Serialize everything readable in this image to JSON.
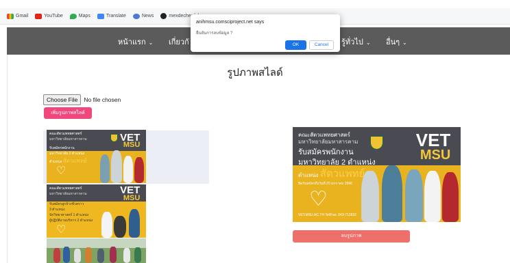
{
  "bookmarks": [
    {
      "label": "Gmail",
      "icon": "gmail-icon"
    },
    {
      "label": "YouTube",
      "icon": "youtube-icon"
    },
    {
      "label": "Maps",
      "icon": "maps-icon"
    },
    {
      "label": "Translate",
      "icon": "translate-icon"
    },
    {
      "label": "News",
      "icon": "news-icon"
    },
    {
      "label": "mexdechee/php-cr...",
      "icon": "github-icon"
    }
  ],
  "nav": {
    "items": [
      {
        "label": "หน้าแรก",
        "chevron": "⌄"
      },
      {
        "label": "เกี่ยวกั",
        "chevron": ""
      },
      {
        "label": "รู้ทั่วไป",
        "chevron": "⌄"
      },
      {
        "label": "อื่นๆ",
        "chevron": "⌄"
      }
    ]
  },
  "page": {
    "title": "รูปภาพสไลด์",
    "choose_file_label": "Choose File",
    "no_file_text": "No file chosen",
    "add_button_label": "เพิ่มรูปภาพสไลด์",
    "delete_button_label": "ลบรูปภาพ"
  },
  "poster": {
    "brand": "VET",
    "brand_sub": "MSU",
    "faculty": "คณะสัตวแพทยศาสตร์",
    "university": "มหาวิทยาลัยมหาสารคาม",
    "line1": "รับสมัครพนักงาน",
    "line2": "มหาวิทยาลัย 2 ตำแหน่ง",
    "line3_prefix": "ตำแหน่ง",
    "line3_highlight": "สัตวแพทย์",
    "deadline": "ปิดรับสมัครถึงวันที่ 20 มกราคม 2566",
    "contact": "VET.MSU.AC.TH  Tel/Fax. 043-712832",
    "p2_line1": "รับสมัครลูกจ้างชั่วคราว",
    "p2_line2": "3 ตำแหน่ง",
    "p2_line3": "นักวิทยาศาสตร์ 1 ตำแหน่ง",
    "p2_line4": "ผู้ปฏิบัติงานบริหาร 2 ตำแหน่ง"
  },
  "dialog": {
    "title": "anihmsu.comsciproject.net says",
    "message": "ยืนยันการลบข้อมูล ?",
    "ok_label": "OK",
    "cancel_label": "Cancel"
  },
  "colors": {
    "navbar": "#5b5b5b",
    "add_button": "#f0487c",
    "delete_button": "#ef6f6a",
    "ok_button": "#1a73e8",
    "poster_yellow": "#e9b21f",
    "poster_dark": "#4a4a52"
  }
}
